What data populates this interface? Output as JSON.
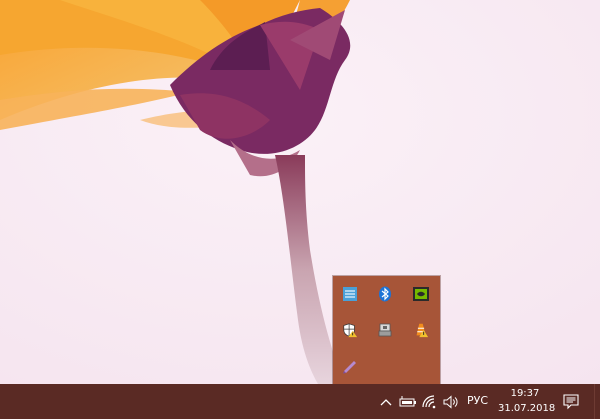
{
  "taskbar": {
    "language": "РУС",
    "time": "19:37",
    "date": "31.07.2018"
  },
  "tray": {
    "expand_icon": "chevron-up-icon",
    "battery_icon": "battery-icon",
    "network_icon": "wifi-icon",
    "volume_icon": "speaker-icon",
    "notification_icon": "action-center-icon"
  },
  "overflow_icons": [
    "network-adapter-icon",
    "bluetooth-icon",
    "nvidia-icon",
    "defender-warning-icon",
    "usb-device-icon",
    "vlc-warning-icon",
    "pen-icon"
  ],
  "colors": {
    "taskbar": "#5a2a24",
    "overflow_panel": "#a75538",
    "desktop": "#f7eaf3"
  }
}
